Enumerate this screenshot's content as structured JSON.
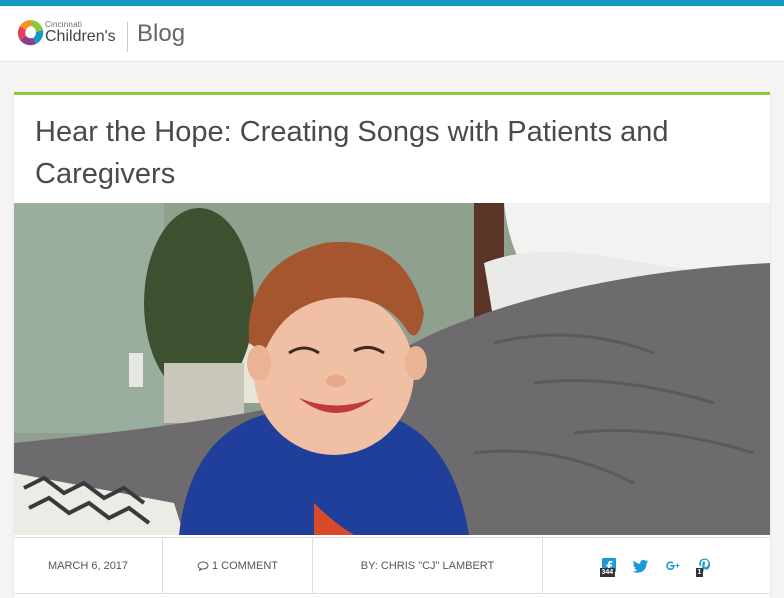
{
  "header": {
    "logo_small": "Cincinnati",
    "logo_big": "Children's",
    "section": "Blog"
  },
  "post": {
    "title": "Hear the Hope: Creating Songs with Patients and Caregivers",
    "image_alt": "Smiling toddler in a blue shirt lying on a bed with gray bedding"
  },
  "meta": {
    "date": "MARCH 6, 2017",
    "comments": "1 COMMENT",
    "author": "BY: CHRIS \"CJ\" LAMBERT"
  },
  "social": {
    "facebook_count": "344",
    "pinterest_count": "1",
    "icons": [
      "facebook-icon",
      "twitter-icon",
      "google-plus-icon",
      "pinterest-icon"
    ]
  },
  "colors": {
    "top_bar": "#109ac4",
    "accent_green": "#8dc63f",
    "social_blue": "#1a9bd7"
  }
}
